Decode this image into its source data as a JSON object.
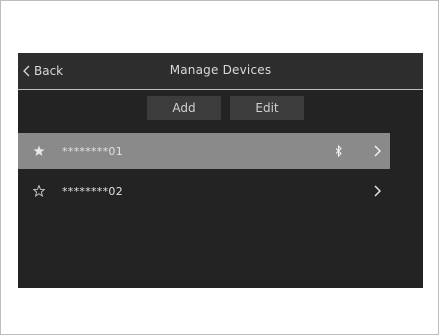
{
  "header": {
    "back_label": "Back",
    "title": "Manage Devices"
  },
  "toolbar": {
    "add_label": "Add",
    "edit_label": "Edit"
  },
  "devices": [
    {
      "name": "********01",
      "favorite": true,
      "selected": true,
      "status_icon": "bluetooth-icon"
    },
    {
      "name": "********02",
      "favorite": false,
      "selected": false,
      "status_icon": ""
    }
  ],
  "colors": {
    "screen_bg": "#232323",
    "header_bg": "#2d2d2d",
    "button_bg": "#3c3c3c",
    "selected_row_bg": "#8a8a8a",
    "text": "#d9d9d9"
  }
}
